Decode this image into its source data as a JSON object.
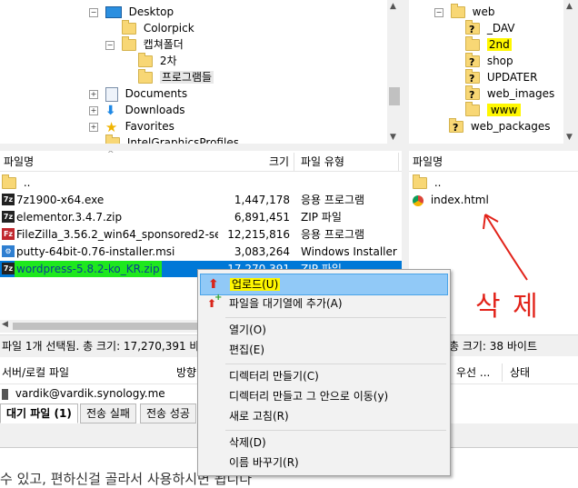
{
  "local_tree": {
    "items": [
      {
        "label": "Desktop"
      },
      {
        "label": "Colorpick"
      },
      {
        "label": "캡쳐폴더"
      },
      {
        "label": "2차"
      },
      {
        "label": "프로그램들"
      },
      {
        "label": "Documents"
      },
      {
        "label": "Downloads"
      },
      {
        "label": "Favorites"
      },
      {
        "label": "IntelGraphicsProfiles"
      }
    ]
  },
  "remote_tree": {
    "items": [
      {
        "label": "web"
      },
      {
        "label": "_DAV"
      },
      {
        "label": "2nd"
      },
      {
        "label": "shop"
      },
      {
        "label": "UPDATER"
      },
      {
        "label": "web_images"
      },
      {
        "label": "www"
      },
      {
        "label": "web_packages"
      }
    ]
  },
  "local_list": {
    "columns": {
      "name": "파일명",
      "size": "크기",
      "type": "파일 유형"
    },
    "parent": "..",
    "files": [
      {
        "name": "7z1900-x64.exe",
        "size": "1,447,178",
        "type": "응용 프로그램"
      },
      {
        "name": "elementor.3.4.7.zip",
        "size": "6,891,451",
        "type": "ZIP 파일"
      },
      {
        "name": "FileZilla_3.56.2_win64_sponsored2-setu...",
        "size": "12,215,816",
        "type": "응용 프로그램"
      },
      {
        "name": "putty-64bit-0.76-installer.msi",
        "size": "3,083,264",
        "type": "Windows Installer ..."
      },
      {
        "name": "wordpress-5.8.2-ko_KR.zip",
        "size": "17,270,391",
        "type": "ZIP 파일"
      }
    ],
    "status": "파일 1개 선택됨. 총 크기: 17,270,391 바"
  },
  "remote_list": {
    "columns": {
      "name": "파일명"
    },
    "parent": "..",
    "files": [
      {
        "name": "index.html"
      }
    ],
    "status": "총 크기: 38 바이트"
  },
  "queue": {
    "columns": {
      "server": "서버/로컬 파일",
      "direction": "방향",
      "priority": "우선 ...",
      "status": "상태"
    },
    "row": "vardik@vardik.synology.me",
    "tabs": [
      "대기 파일 (1)",
      "전송 실패",
      "전송 성공"
    ]
  },
  "context_menu": {
    "items": [
      {
        "label": "업로드(U)"
      },
      {
        "label": "파일을 대기열에 추가(A)"
      },
      {
        "label": "열기(O)"
      },
      {
        "label": "편집(E)"
      },
      {
        "label": "디렉터리 만들기(C)"
      },
      {
        "label": "디렉터리 만들고 그 안으로 이동(y)"
      },
      {
        "label": "새로 고침(R)"
      },
      {
        "label": "삭제(D)"
      },
      {
        "label": "이름 바꾸기(R)"
      }
    ]
  },
  "annotation": {
    "text": "삭 제"
  },
  "bottom_text": "수 있고, 편하신걸 골라서 사용하시면 됩니다",
  "colors": {
    "highlight_yellow": "#fff700",
    "highlight_green": "#1ee81e",
    "selection_blue": "#0078d7",
    "annotation_red": "#e2231a"
  }
}
